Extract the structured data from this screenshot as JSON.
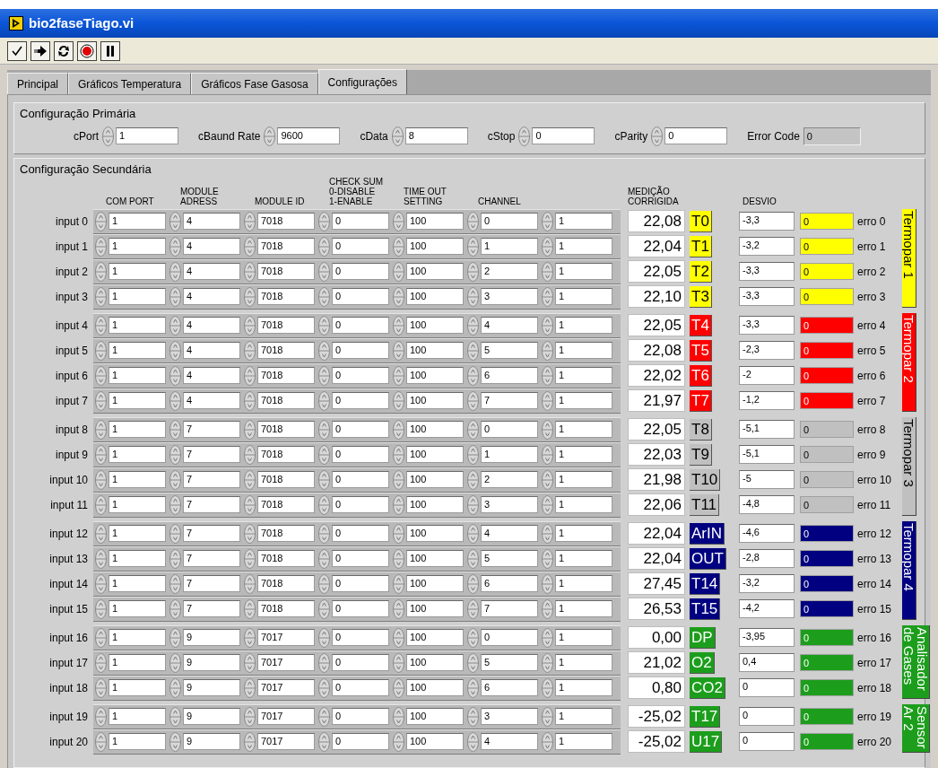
{
  "window": {
    "title": "bio2faseTiago.vi"
  },
  "toolbar": [
    {
      "kind": "check"
    },
    {
      "kind": "run"
    },
    {
      "kind": "loop"
    },
    {
      "kind": "stop"
    },
    {
      "kind": "pause"
    }
  ],
  "tabs": [
    {
      "label": "Principal",
      "selected": false
    },
    {
      "label": "Gráficos Temperatura",
      "selected": false
    },
    {
      "label": "Gráficos Fase Gasosa",
      "selected": false
    },
    {
      "label": "Configurações",
      "selected": true
    }
  ],
  "primary": {
    "title": "Configuração Primária",
    "fields": [
      {
        "label": "cPort",
        "value": "1",
        "kind": "control"
      },
      {
        "label": "cBaund Rate",
        "value": "9600",
        "kind": "control"
      },
      {
        "label": "cData",
        "value": "8",
        "kind": "control"
      },
      {
        "label": "cStop",
        "value": "0",
        "kind": "control"
      },
      {
        "label": "cParity",
        "value": "0",
        "kind": "control"
      },
      {
        "label": "Error Code",
        "value": "0",
        "kind": "indicator"
      }
    ]
  },
  "secondary": {
    "title": "Configuração Secundária",
    "columns": [
      {
        "lines": [
          "COM PORT"
        ]
      },
      {
        "lines": [
          "MODULE",
          "ADRESS"
        ]
      },
      {
        "lines": [
          "MODULE ID"
        ]
      },
      {
        "lines": [
          "CHECK SUM",
          "0-DISABLE",
          "1-ENABLE"
        ]
      },
      {
        "lines": [
          "TIME OUT",
          "SETTING"
        ]
      },
      {
        "lines": [
          "CHANNEL"
        ]
      }
    ],
    "reading_header": {
      "lines": [
        "MEDIÇÃO",
        "CORRIGIDA"
      ]
    },
    "deviation_header": {
      "lines": [
        "DESVIO"
      ]
    },
    "groups": [
      {
        "lines": [
          "Termopar 1"
        ],
        "color": "#ffff00",
        "rows": [
          {
            "label": "input 0",
            "values": [
              "1",
              "4",
              "7018",
              "0",
              "100",
              "0",
              "1"
            ],
            "reading": "22,08",
            "tag": "T0",
            "deviation": "-3,3",
            "error": "0",
            "error_label": "erro 0"
          },
          {
            "label": "input 1",
            "values": [
              "1",
              "4",
              "7018",
              "0",
              "100",
              "1",
              "1"
            ],
            "reading": "22,04",
            "tag": "T1",
            "deviation": "-3,2",
            "error": "0",
            "error_label": "erro 1"
          },
          {
            "label": "input 2",
            "values": [
              "1",
              "4",
              "7018",
              "0",
              "100",
              "2",
              "1"
            ],
            "reading": "22,05",
            "tag": "T2",
            "deviation": "-3,3",
            "error": "0",
            "error_label": "erro 2"
          },
          {
            "label": "input 3",
            "values": [
              "1",
              "4",
              "7018",
              "0",
              "100",
              "3",
              "1"
            ],
            "reading": "22,10",
            "tag": "T3",
            "deviation": "-3,3",
            "error": "0",
            "error_label": "erro 3"
          }
        ]
      },
      {
        "lines": [
          "Termopar 2"
        ],
        "color": "#ff0000",
        "rows": [
          {
            "label": "input 4",
            "values": [
              "1",
              "4",
              "7018",
              "0",
              "100",
              "4",
              "1"
            ],
            "reading": "22,05",
            "tag": "T4",
            "deviation": "-3,3",
            "error": "0",
            "error_label": "erro 4"
          },
          {
            "label": "input 5",
            "values": [
              "1",
              "4",
              "7018",
              "0",
              "100",
              "5",
              "1"
            ],
            "reading": "22,08",
            "tag": "T5",
            "deviation": "-2,3",
            "error": "0",
            "error_label": "erro 5"
          },
          {
            "label": "input 6",
            "values": [
              "1",
              "4",
              "7018",
              "0",
              "100",
              "6",
              "1"
            ],
            "reading": "22,02",
            "tag": "T6",
            "deviation": "-2",
            "error": "0",
            "error_label": "erro 6"
          },
          {
            "label": "input 7",
            "values": [
              "1",
              "4",
              "7018",
              "0",
              "100",
              "7",
              "1"
            ],
            "reading": "21,97",
            "tag": "T7",
            "deviation": "-1,2",
            "error": "0",
            "error_label": "erro 7"
          }
        ]
      },
      {
        "lines": [
          "Termopar 3"
        ],
        "color": "#c0c0c0",
        "rows": [
          {
            "label": "input 8",
            "values": [
              "1",
              "7",
              "7018",
              "0",
              "100",
              "0",
              "1"
            ],
            "reading": "22,05",
            "tag": "T8",
            "deviation": "-5,1",
            "error": "0",
            "error_label": "erro 8"
          },
          {
            "label": "input 9",
            "values": [
              "1",
              "7",
              "7018",
              "0",
              "100",
              "1",
              "1"
            ],
            "reading": "22,03",
            "tag": "T9",
            "deviation": "-5,1",
            "error": "0",
            "error_label": "erro 9"
          },
          {
            "label": "input 10",
            "values": [
              "1",
              "7",
              "7018",
              "0",
              "100",
              "2",
              "1"
            ],
            "reading": "21,98",
            "tag": "T10",
            "deviation": "-5",
            "error": "0",
            "error_label": "erro 10"
          },
          {
            "label": "input 11",
            "values": [
              "1",
              "7",
              "7018",
              "0",
              "100",
              "3",
              "1"
            ],
            "reading": "22,06",
            "tag": "T11",
            "deviation": "-4,8",
            "error": "0",
            "error_label": "erro 11"
          }
        ]
      },
      {
        "lines": [
          "Termopar 4"
        ],
        "color": "#000080",
        "rows": [
          {
            "label": "input 12",
            "values": [
              "1",
              "7",
              "7018",
              "0",
              "100",
              "4",
              "1"
            ],
            "reading": "22,04",
            "tag": "ArIN",
            "deviation": "-4,6",
            "error": "0",
            "error_label": "erro 12"
          },
          {
            "label": "input 13",
            "values": [
              "1",
              "7",
              "7018",
              "0",
              "100",
              "5",
              "1"
            ],
            "reading": "22,04",
            "tag": "OUT",
            "deviation": "-2,8",
            "error": "0",
            "error_label": "erro 13"
          },
          {
            "label": "input 14",
            "values": [
              "1",
              "7",
              "7018",
              "0",
              "100",
              "6",
              "1"
            ],
            "reading": "27,45",
            "tag": "T14",
            "deviation": "-3,2",
            "error": "0",
            "error_label": "erro 14"
          },
          {
            "label": "input 15",
            "values": [
              "1",
              "7",
              "7018",
              "0",
              "100",
              "7",
              "1"
            ],
            "reading": "26,53",
            "tag": "T15",
            "deviation": "-4,2",
            "error": "0",
            "error_label": "erro 15"
          }
        ]
      },
      {
        "lines": [
          "Analisador",
          "de Gases"
        ],
        "color": "#1c9e1c",
        "rows": [
          {
            "label": "input 16",
            "values": [
              "1",
              "9",
              "7017",
              "0",
              "100",
              "0",
              "1"
            ],
            "reading": "0,00",
            "tag": "DP",
            "deviation": "-3,95",
            "error": "0",
            "error_label": "erro 16"
          },
          {
            "label": "input 17",
            "values": [
              "1",
              "9",
              "7017",
              "0",
              "100",
              "5",
              "1"
            ],
            "reading": "21,02",
            "tag": "O2",
            "deviation": "0,4",
            "error": "0",
            "error_label": "erro 17"
          },
          {
            "label": "input 18",
            "values": [
              "1",
              "9",
              "7017",
              "0",
              "100",
              "6",
              "1"
            ],
            "reading": "0,80",
            "tag": "CO2",
            "deviation": "0",
            "error": "0",
            "error_label": "erro 18"
          }
        ]
      },
      {
        "lines": [
          "Sensor",
          "Ar 2"
        ],
        "color": "#1c9e1c",
        "rows": [
          {
            "label": "input 19",
            "values": [
              "1",
              "9",
              "7017",
              "0",
              "100",
              "3",
              "1"
            ],
            "reading": "-25,02",
            "tag": "T17",
            "deviation": "0",
            "error": "0",
            "error_label": "erro 19"
          },
          {
            "label": "input 20",
            "values": [
              "1",
              "9",
              "7017",
              "0",
              "100",
              "4",
              "1"
            ],
            "reading": "-25,02",
            "tag": "U17",
            "deviation": "0",
            "error": "0",
            "error_label": "erro 20"
          }
        ]
      }
    ]
  }
}
